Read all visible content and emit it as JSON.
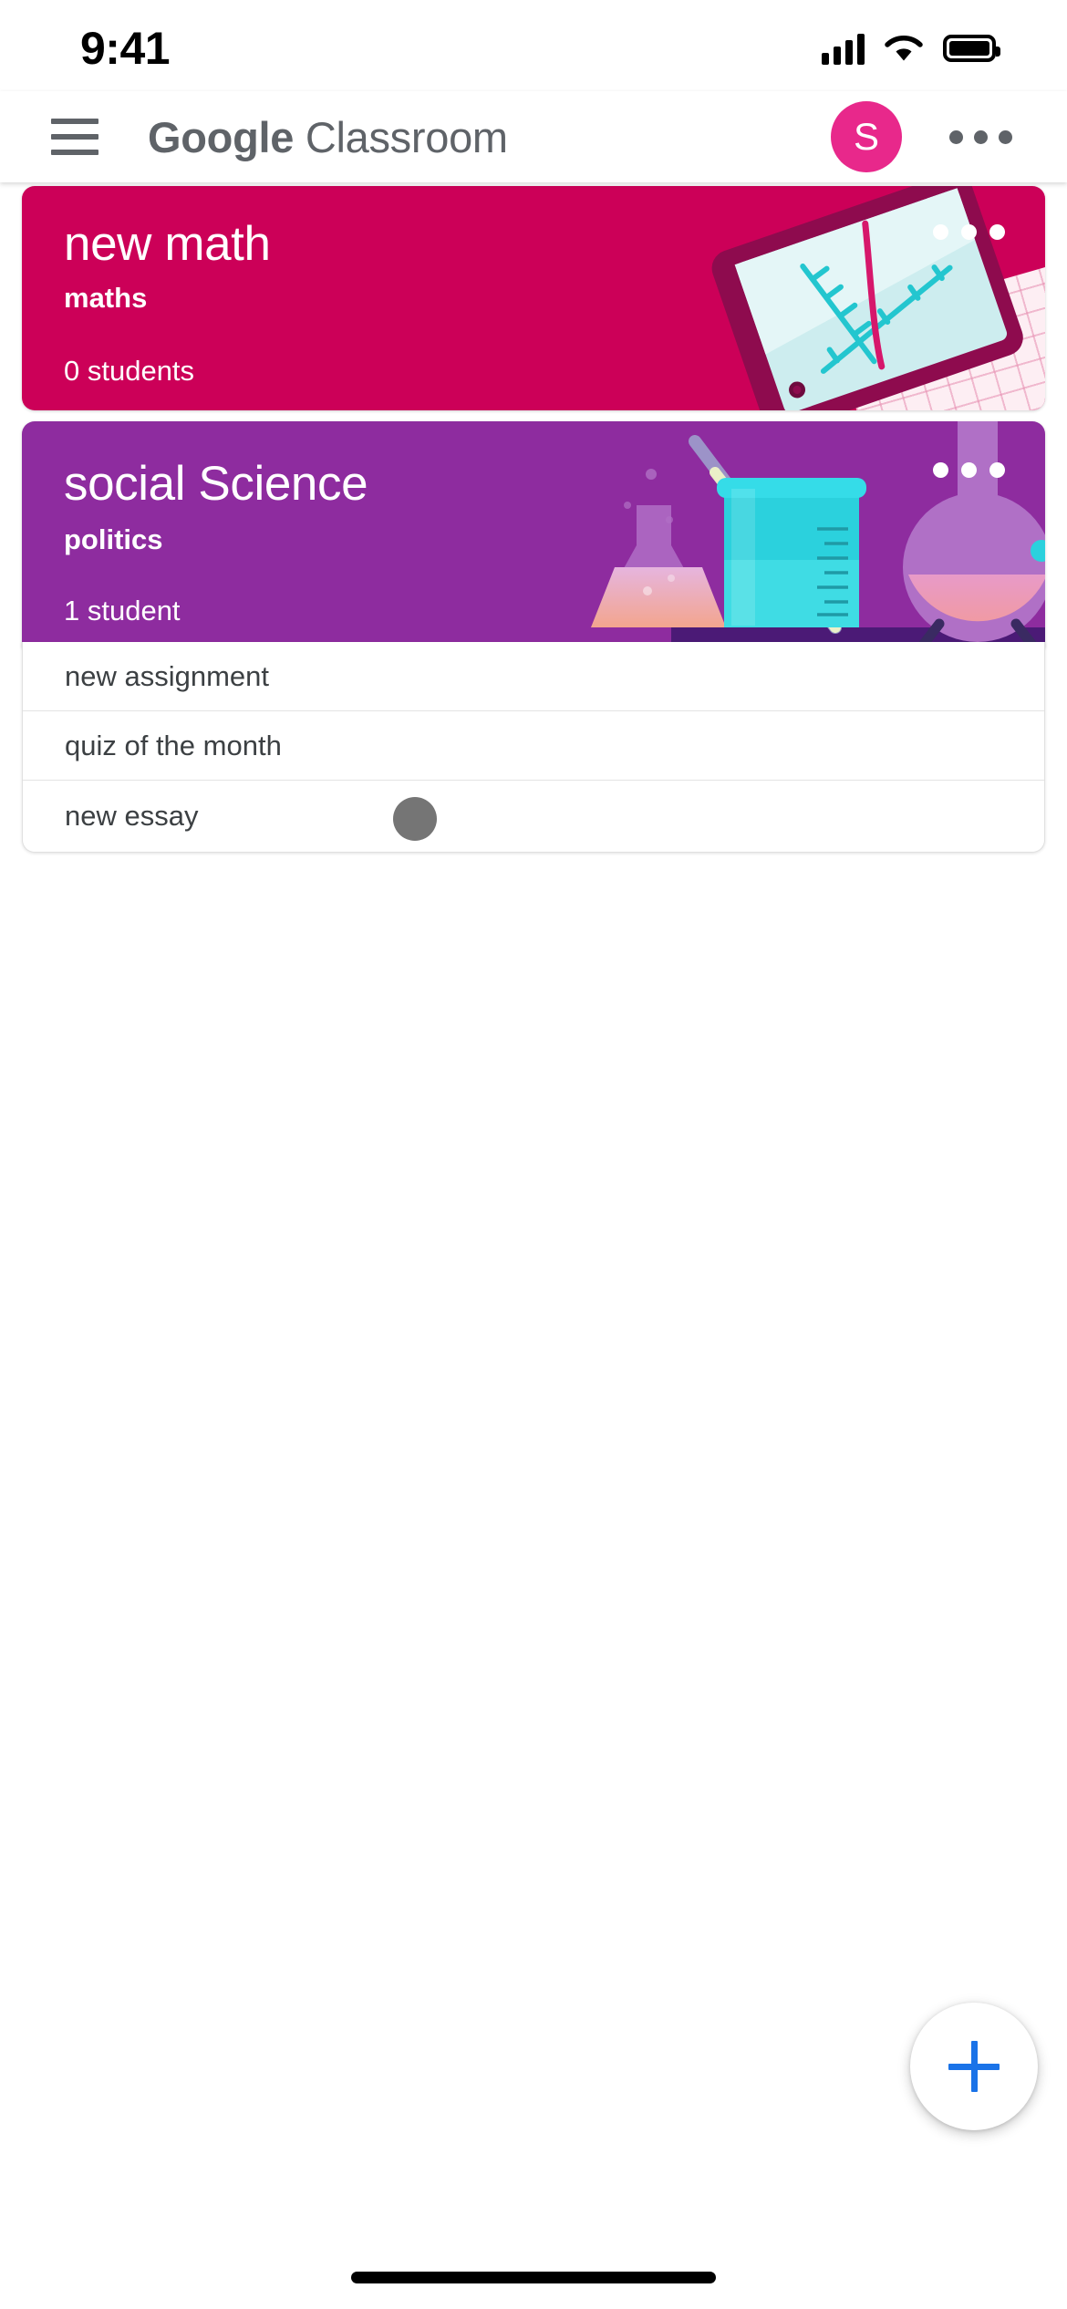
{
  "status_bar": {
    "time": "9:41",
    "signal_icon": "cellular-signal-icon",
    "wifi_icon": "wifi-icon",
    "battery_icon": "battery-icon"
  },
  "app_bar": {
    "menu_icon": "hamburger-menu-icon",
    "brand_bold": "Google",
    "brand_light": "Classroom",
    "avatar_initial": "S",
    "avatar_color": "#E8288B",
    "overflow_icon": "more-options-icon"
  },
  "courses": [
    {
      "title": "new math",
      "section": "maths",
      "students": "0 students",
      "color": "#CC0058",
      "overflow_icon": "course-more-options-icon",
      "illustration": "math-tablet-graph-illustration"
    },
    {
      "title": "social Science",
      "section": "politics",
      "students": "1 student",
      "color": "#8E2C9F",
      "overflow_icon": "course-more-options-icon",
      "illustration": "science-lab-glassware-illustration"
    }
  ],
  "assignments": [
    {
      "label": "new assignment"
    },
    {
      "label": "quiz of the month"
    },
    {
      "label": "new essay"
    }
  ],
  "fab": {
    "icon": "plus-icon",
    "color": "#1A73E8"
  },
  "home_indicator": "home-indicator-bar"
}
